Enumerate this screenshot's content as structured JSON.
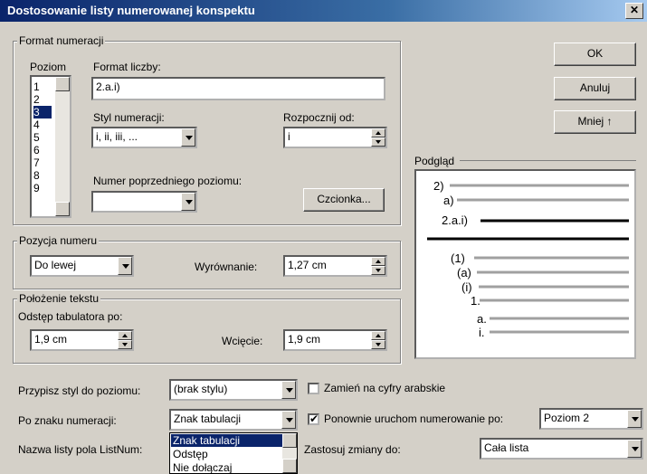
{
  "title": "Dostosowanie listy numerowanej konspektu",
  "buttons": {
    "ok": "OK",
    "cancel": "Anuluj",
    "less": "Mniej",
    "less_arrow": "↑",
    "font": "Czcionka..."
  },
  "format_group": {
    "legend": "Format numeracji",
    "level_label": "Poziom",
    "levels": [
      "1",
      "2",
      "3",
      "4",
      "5",
      "6",
      "7",
      "8",
      "9"
    ],
    "selected_level": "3",
    "number_format_label": "Format liczby:",
    "number_format_value": "2.a.i)",
    "style_label": "Styl numeracji:",
    "style_value": "i, ii, iii, ...",
    "start_label": "Rozpocznij od:",
    "start_value": "i",
    "prev_level_label": "Numer poprzedniego poziomu:",
    "prev_level_value": ""
  },
  "position_group": {
    "legend": "Pozycja numeru",
    "alignment_value": "Do lewej",
    "aligned_at_label": "Wyrównanie:",
    "aligned_at_value": "1,27 cm"
  },
  "text_group": {
    "legend": "Położenie tekstu",
    "tab_label": "Odstęp tabulatora po:",
    "tab_value": "1,9 cm",
    "indent_label": "Wcięcie:",
    "indent_value": "1,9 cm"
  },
  "preview": {
    "label": "Podgląd",
    "items": [
      "2)",
      "a)",
      "2.a.i)",
      "(1)",
      "(a)",
      "(i)",
      "1.",
      "a.",
      "i."
    ]
  },
  "bottom": {
    "link_style_label": "Przypisz styl do poziomu:",
    "link_style_value": "(brak stylu)",
    "legal_label": "Zamień na cyfry arabskie",
    "legal_checked": false,
    "follow_label": "Po znaku numeracji:",
    "follow_value": "Znak tabulacji",
    "restart_label": "Ponownie uruchom numerowanie po:",
    "restart_checked": true,
    "restart_value": "Poziom 2",
    "listnum_label": "Nazwa listy pola ListNum:",
    "apply_label": "Zastosuj zmiany do:",
    "apply_value": "Cała lista",
    "dropdown_options": [
      "Znak tabulacji",
      "Odstęp",
      "Nie dołączaj"
    ],
    "dropdown_selected": "Znak tabulacji"
  }
}
